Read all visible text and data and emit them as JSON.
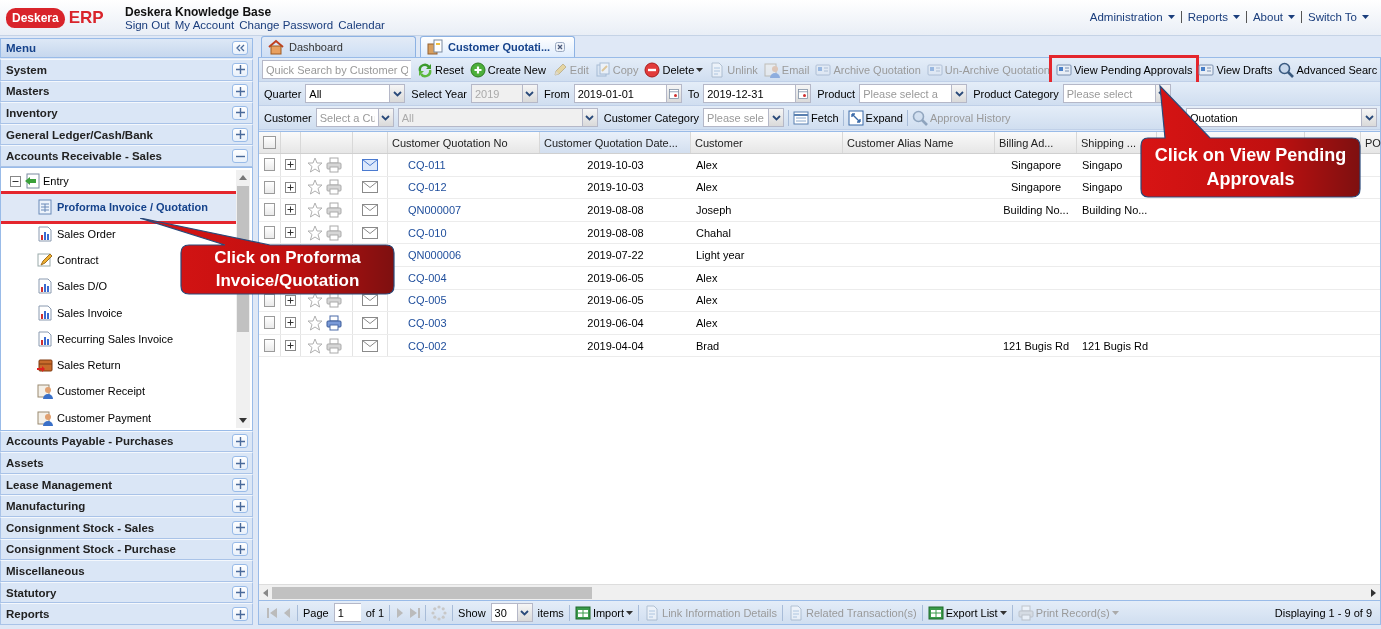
{
  "header": {
    "logo_mark": "Deskera",
    "logo_text": "ERP",
    "title": "Deskera Knowledge Base",
    "links": [
      "Sign Out",
      "My Account",
      "Change Password",
      "Calendar"
    ],
    "menus": [
      "Administration",
      "Reports",
      "About",
      "Switch To"
    ]
  },
  "sidebar": {
    "title": "Menu",
    "sections": [
      {
        "label": "System",
        "expanded": false
      },
      {
        "label": "Masters",
        "expanded": false
      },
      {
        "label": "Inventory",
        "expanded": false
      },
      {
        "label": "General Ledger/Cash/Bank",
        "expanded": false
      },
      {
        "label": "Accounts Receivable - Sales",
        "expanded": true,
        "tree": [
          {
            "label": "Entry",
            "expanded": true,
            "selected": false,
            "highlighted": false,
            "children": [
              {
                "label": "Proforma Invoice / Quotation",
                "selected": true,
                "highlighted": true
              },
              {
                "label": "Sales Order",
                "selected": false,
                "highlighted": false
              },
              {
                "label": "Contract",
                "selected": false,
                "highlighted": false
              },
              {
                "label": "Sales D/O",
                "selected": false,
                "highlighted": false
              },
              {
                "label": "Sales Invoice",
                "selected": false,
                "highlighted": false
              },
              {
                "label": "Recurring Sales Invoice",
                "selected": false,
                "highlighted": false
              },
              {
                "label": "Sales Return",
                "selected": false,
                "highlighted": false
              },
              {
                "label": "Customer Receipt",
                "selected": false,
                "highlighted": false
              },
              {
                "label": "Customer Payment",
                "selected": false,
                "highlighted": false
              }
            ]
          }
        ]
      },
      {
        "label": "Accounts Payable - Purchases",
        "expanded": false
      },
      {
        "label": "Assets",
        "expanded": false
      },
      {
        "label": "Lease Management",
        "expanded": false
      },
      {
        "label": "Manufacturing",
        "expanded": false
      },
      {
        "label": "Consignment Stock - Sales",
        "expanded": false
      },
      {
        "label": "Consignment Stock - Purchase",
        "expanded": false
      },
      {
        "label": "Miscellaneous",
        "expanded": false
      },
      {
        "label": "Statutory",
        "expanded": false
      },
      {
        "label": "Reports",
        "expanded": false
      }
    ]
  },
  "tabs": [
    {
      "label": "Dashboard",
      "selected": false,
      "closable": false
    },
    {
      "label": "Customer Quotati...",
      "selected": true,
      "closable": true
    }
  ],
  "search": {
    "placeholder": "Quick Search by Customer Q"
  },
  "toolbar": [
    {
      "label": "Reset",
      "disabled": false,
      "dropdown": false,
      "highlighted": false
    },
    {
      "label": "Create New",
      "disabled": false,
      "dropdown": false,
      "highlighted": false
    },
    {
      "label": "Edit",
      "disabled": true,
      "dropdown": false,
      "highlighted": false
    },
    {
      "label": "Copy",
      "disabled": true,
      "dropdown": false,
      "highlighted": false
    },
    {
      "label": "Delete",
      "disabled": false,
      "dropdown": true,
      "highlighted": false
    },
    {
      "label": "Unlink",
      "disabled": true,
      "dropdown": false,
      "highlighted": false
    },
    {
      "label": "Email",
      "disabled": true,
      "dropdown": false,
      "highlighted": false
    },
    {
      "label": "Archive Quotation",
      "disabled": true,
      "dropdown": false,
      "highlighted": false
    },
    {
      "label": "Un-Archive Quotation",
      "disabled": true,
      "dropdown": false,
      "highlighted": false
    },
    {
      "label": "View Pending Approvals",
      "disabled": false,
      "dropdown": false,
      "highlighted": true
    },
    {
      "label": "View Drafts",
      "disabled": false,
      "dropdown": false,
      "highlighted": false
    },
    {
      "label": "Advanced Searc",
      "disabled": false,
      "dropdown": false,
      "highlighted": false
    }
  ],
  "filters": {
    "row1": [
      {
        "kind": "combo",
        "label": "Quarter",
        "value": "All",
        "disabled": false
      },
      {
        "kind": "combo",
        "label": "Select Year",
        "value": "2019",
        "disabled": true
      },
      {
        "kind": "date",
        "label": "From",
        "value": "2019-01-01",
        "disabled": false
      },
      {
        "kind": "date",
        "label": "To",
        "value": "2019-12-31",
        "disabled": false
      },
      {
        "kind": "combo",
        "label": "Product",
        "placeholder": "Please select a",
        "disabled": false
      },
      {
        "kind": "combo",
        "label": "Product Category",
        "placeholder": "Please select",
        "disabled": false
      }
    ],
    "row2": [
      {
        "kind": "combo",
        "label": "Customer",
        "placeholder": "Select a Cu",
        "disabled": false
      },
      {
        "kind": "combo",
        "value": "All",
        "disabled": true
      },
      {
        "kind": "combo",
        "label": "Customer Category",
        "placeholder": "Please sele",
        "disabled": false
      },
      {
        "kind": "button",
        "label": "Fetch",
        "disabled": false
      },
      {
        "kind": "button",
        "label": "Expand",
        "disabled": false
      },
      {
        "kind": "button",
        "label": "Approval History",
        "disabled": true
      }
    ],
    "view": {
      "value": "Quotation"
    }
  },
  "grid": {
    "all_checked": false,
    "columns": [
      {
        "label": "Customer Quotation No",
        "highlighted": false
      },
      {
        "label": "Customer Quotation Date...",
        "highlighted": true
      },
      {
        "label": "Customer",
        "highlighted": false
      },
      {
        "label": "Customer Alias Name",
        "highlighted": false
      },
      {
        "label": "Billing Ad...",
        "highlighted": false
      },
      {
        "label": "Shipping ...",
        "highlighted": false
      },
      {
        "label": "PO",
        "highlighted": false
      }
    ],
    "rows": [
      {
        "checked": false,
        "print_active": false,
        "mail_active": true,
        "no": "CQ-011",
        "date": "2019-10-03",
        "customer": "Alex",
        "billing": "Singapore",
        "shipping": "Singapo"
      },
      {
        "checked": false,
        "print_active": false,
        "mail_active": false,
        "no": "CQ-012",
        "date": "2019-10-03",
        "customer": "Alex",
        "billing": "Singapore",
        "shipping": "Singapo"
      },
      {
        "checked": false,
        "print_active": false,
        "mail_active": false,
        "no": "QN000007",
        "date": "2019-08-08",
        "customer": "Joseph",
        "billing": "Building No...",
        "shipping": "Building No..."
      },
      {
        "checked": false,
        "print_active": false,
        "mail_active": false,
        "no": "CQ-010",
        "date": "2019-08-08",
        "customer": "Chahal"
      },
      {
        "no": "QN000006",
        "date": "2019-07-22",
        "customer": "Light year"
      },
      {
        "no": "CQ-004",
        "date": "2019-06-05",
        "customer": "Alex"
      },
      {
        "checked": false,
        "print_active": false,
        "mail_active": false,
        "no": "CQ-005",
        "date": "2019-06-05",
        "customer": "Alex"
      },
      {
        "checked": false,
        "print_active": true,
        "mail_active": false,
        "no": "CQ-003",
        "date": "2019-06-04",
        "customer": "Alex"
      },
      {
        "checked": false,
        "print_active": false,
        "mail_active": false,
        "no": "CQ-002",
        "date": "2019-04-04",
        "customer": "Brad",
        "billing": "121 Bugis Rd",
        "shipping": "121 Bugis Rd"
      }
    ]
  },
  "paging": {
    "page_label": "Page",
    "page": "1",
    "page_count": "of 1",
    "show_label": "Show",
    "page_size": "30",
    "items_label": "items",
    "buttons": [
      {
        "label": "Import",
        "disabled": false,
        "dropdown": true
      },
      {
        "label": "Link Information Details",
        "disabled": true,
        "dropdown": false
      },
      {
        "label": "Related Transaction(s)",
        "disabled": true,
        "dropdown": false
      },
      {
        "label": "Export List",
        "disabled": false,
        "dropdown": true
      },
      {
        "label": "Print Record(s)",
        "disabled": true,
        "dropdown": true
      }
    ],
    "status": "Displaying 1 - 9 of 9"
  },
  "callouts": [
    {
      "text": "Click on Proforma Invoice/Quotation"
    },
    {
      "text": "Click on View Pending Approvals"
    }
  ]
}
